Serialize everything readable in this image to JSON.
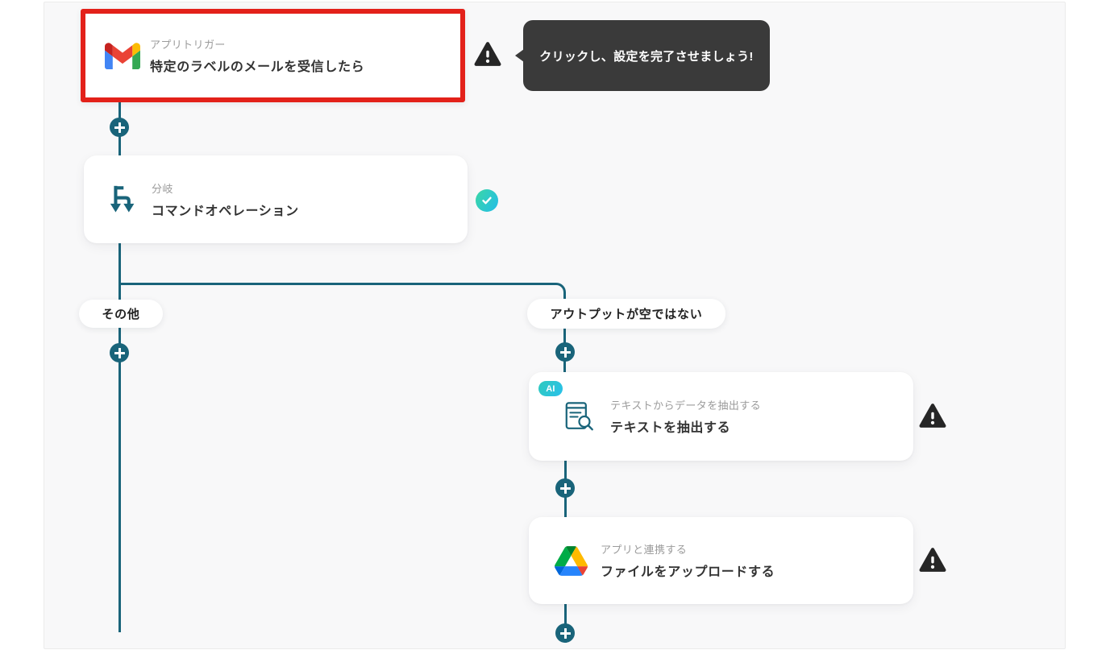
{
  "workflow": {
    "trigger": {
      "category": "アプリトリガー",
      "title": "特定のラベルのメールを受信したら",
      "app": "Gmail",
      "status": "needs-setup"
    },
    "tooltip": {
      "text": "クリックし、設定を完了させましょう!"
    },
    "branch": {
      "category": "分岐",
      "title": "コマンドオペレーション",
      "status": "complete"
    },
    "branch_labels": {
      "left": "その他",
      "right": "アウトプットが空ではない"
    },
    "extract": {
      "badge": "AI",
      "category": "テキストからデータを抽出する",
      "title": "テキストを抽出する",
      "status": "needs-setup"
    },
    "upload": {
      "category": "アプリと連携する",
      "title": "ファイルをアップロードする",
      "app": "Google Drive",
      "status": "needs-setup"
    }
  },
  "colors": {
    "accent_teal": "#19647a",
    "highlight_red": "#e3211a",
    "tooltip_bg": "#3a3a3a",
    "warning_dark": "#262626",
    "check_gradient": "#3bd7a5 → #23bde9",
    "ai_badge_gradient": "#2fcabe → #29c0ea",
    "canvas_bg": "#f8f8f9"
  }
}
